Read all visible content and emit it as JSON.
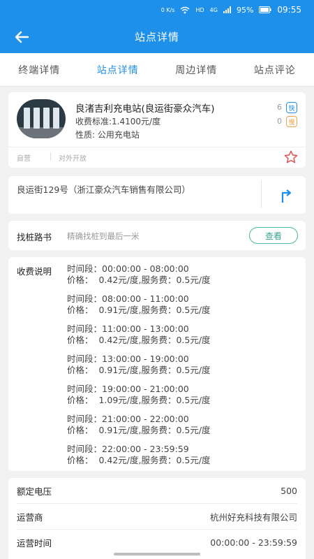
{
  "status_bar": {
    "net_speed": "0 K/s",
    "hd": "HD",
    "network": "4G",
    "battery": "95%",
    "time": "09:55"
  },
  "app_bar": {
    "title": "站点详情"
  },
  "tabs": [
    {
      "label": "终端详情"
    },
    {
      "label": "站点详情"
    },
    {
      "label": "周边详情"
    },
    {
      "label": "站点评论"
    }
  ],
  "station": {
    "name": "良渚吉利充电站(良运街豪众汽车)",
    "fee": "收费标准:1.4100元/度",
    "nature": "性质: 公用充电站",
    "fast_count": "6",
    "fast_label": "快",
    "slow_count": "0",
    "slow_label": "慢",
    "tag_operation": "自营",
    "tag_open": "对外开放"
  },
  "address": {
    "text": "良运街129号（浙江豪众汽车销售有限公司）"
  },
  "guide": {
    "label": "找桩路书",
    "hint": "精确找桩到最后一米",
    "button": "查看"
  },
  "fees": {
    "label": "收费说明",
    "periods": [
      {
        "time": "时间段：00:00:00 - 08:00:00",
        "price": "价格：  0.42元/度,服务费：0.5元/度"
      },
      {
        "time": "时间段：08:00:00 - 11:00:00",
        "price": "价格：  0.91元/度,服务费：0.5元/度"
      },
      {
        "time": "时间段：11:00:00 - 13:00:00",
        "price": "价格：  0.42元/度,服务费：0.5元/度"
      },
      {
        "time": "时间段：13:00:00 - 19:00:00",
        "price": "价格：  0.91元/度,服务费：0.5元/度"
      },
      {
        "time": "时间段：19:00:00 - 21:00:00",
        "price": "价格：  1.09元/度,服务费：0.5元/度"
      },
      {
        "time": "时间段：21:00:00 - 22:00:00",
        "price": "价格：  0.91元/度,服务费：0.5元/度"
      },
      {
        "time": "时间段：22:00:00 - 23:59:59",
        "price": "价格：  0.42元/度,服务费：0.5元/度"
      }
    ]
  },
  "info": [
    {
      "key": "额定电压",
      "value": "500"
    },
    {
      "key": "运营商",
      "value": "杭州好充科技有限公司"
    },
    {
      "key": "运营时间",
      "value": "00:00:00 - 23:59:59"
    }
  ],
  "colors": {
    "primary": "#1e90ea",
    "accent_green": "#3aa692",
    "star_red": "#e05050",
    "slow_orange": "#f0a14a"
  }
}
